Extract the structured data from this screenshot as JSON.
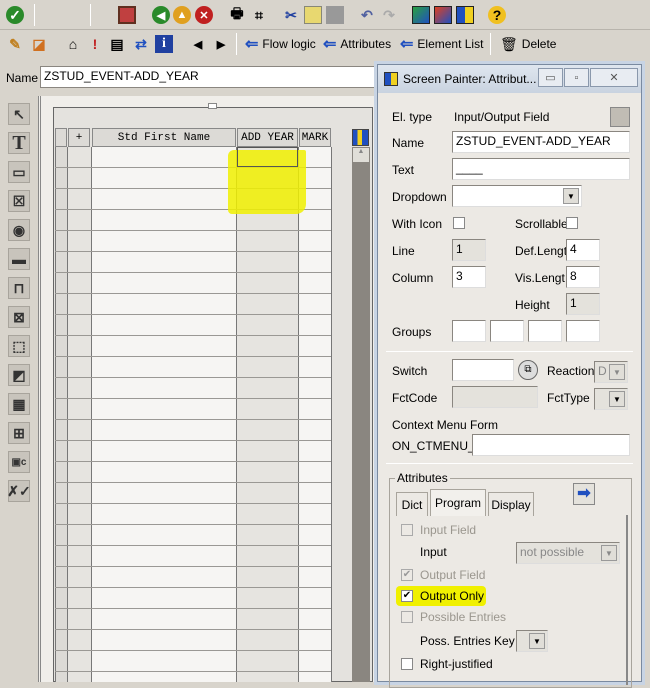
{
  "toolbar1": {
    "icons": [
      "enter-icon",
      "save-icon",
      "back-icon",
      "exit-icon",
      "cancel-icon",
      "print-icon",
      "find-icon",
      "cut-icon",
      "copy-icon",
      "paste-icon",
      "undo-icon",
      "redo-icon",
      "layout-icon",
      "layout2-icon",
      "attributes-icon",
      "help-icon"
    ]
  },
  "toolbar2": {
    "flow_logic": "Flow logic",
    "attributes": "Attributes",
    "element_list": "Element List",
    "delete": "Delete"
  },
  "name_label": "Name",
  "name_value": "ZSTUD_EVENT-ADD_YEAR",
  "table": {
    "plus": "+",
    "columns": [
      "Std First Name",
      "ADD YEAR",
      "MARK"
    ]
  },
  "dialog": {
    "title": "Screen Painter: Attribut...",
    "el_type_label": "El. type",
    "el_type": "Input/Output Field",
    "name_label": "Name",
    "name": "ZSTUD_EVENT-ADD_YEAR",
    "text_label": "Text",
    "text": "____",
    "dropdown_label": "Dropdown",
    "with_icon_label": "With Icon",
    "scrollable_label": "Scrollable",
    "line_label": "Line",
    "line": "1",
    "def_length_label": "Def.Lengt",
    "def_length": "4",
    "column_label": "Column",
    "column": "3",
    "vis_length_label": "Vis.Length",
    "vis_length": "8",
    "height_label": "Height",
    "height": "1",
    "groups_label": "Groups",
    "switch_label": "Switch",
    "reaction_label": "Reaction",
    "reaction": "D",
    "fctcode_label": "FctCode",
    "fcttype_label": "FctType",
    "context_menu_label": "Context Menu Form",
    "context_prefix": "ON_CTMENU_",
    "attributes_group": "Attributes",
    "tabs": [
      "Dict",
      "Program",
      "Display"
    ],
    "input_field": "Input Field",
    "input_label": "Input",
    "input_value": "not possible",
    "output_field": "Output Field",
    "output_only": "Output Only",
    "possible_entries": "Possible Entries",
    "poss_entries_key": "Poss. Entries Key",
    "right_justified": "Right-justified"
  }
}
